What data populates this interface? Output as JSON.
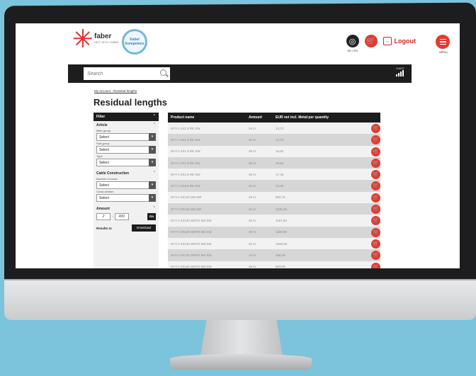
{
  "header": {
    "brand": "faber",
    "brand_sub": "SEIT 1875 • KABEL",
    "seal_text": "Kabel Kompetenz",
    "lang": "DE / EN",
    "logout": "Logout",
    "menu": "MENU"
  },
  "search": {
    "placeholder": "Search",
    "chart_label": "CHART"
  },
  "breadcrumb": "My account › Residual lengths",
  "page_title": "Residual lengths",
  "filter": {
    "title": "Filter",
    "article_title": "Article",
    "main_group_label": "Main group",
    "main_group_value": "Select",
    "sub_group_label": "Sub-group",
    "sub_group_value": "Select",
    "type_label": "Type",
    "type_value": "Select",
    "cable_title": "Cable Construction",
    "cores_label": "Number of cores",
    "cores_value": "Select",
    "cross_label": "Cross-section",
    "cross_value": "Select",
    "amount_title": "Amount",
    "amount_from": "2",
    "amount_sep": "-",
    "amount_to": "499",
    "go": "Go",
    "results_label": "Results to",
    "download": "Download"
  },
  "table": {
    "headers": [
      "Product name",
      "Amount",
      "EUR net incl. Metal per quantity"
    ],
    "rows": [
      [
        "NYY-J 1X1.5 RE SW",
        "25 m",
        "13,73"
      ],
      [
        "NYY-J 3X1.5 RE SW",
        "30 m",
        "13,73"
      ],
      [
        "NYY-J 3X1.5 RE SW",
        "25 m",
        "15,82"
      ],
      [
        "NYY-J 3X1.5 RE SW",
        "36 m",
        "15,84"
      ],
      [
        "NYY-J 3X1.5 RE SW",
        "39 m",
        "17,19"
      ],
      [
        "NYY-J 3X2.5 RE SW",
        "26 m",
        "23,20"
      ],
      [
        "NYY-J 3X120 SM SW",
        "48 m",
        "893,75"
      ],
      [
        "NYY-J 3X120 SM SW",
        "32 m",
        "1135,40"
      ],
      [
        "NYY-J 3X120 SM/70 SM SW",
        "40 m",
        "1157,50"
      ],
      [
        "NYY-J 3X120 SM/70 SM SW",
        "40 m",
        "1159,00"
      ],
      [
        "NYY-J 3X120 SM/70 SM SW",
        "32 m",
        "1028,66"
      ],
      [
        "NYY-J 3X120 SM/70 SM SW",
        "14 m",
        "458,35"
      ],
      [
        "NYY-J 3X120 SM/70 SM SW",
        "28 m",
        "903,09"
      ]
    ]
  },
  "colors": {
    "accent": "#e53a2f",
    "dark": "#1d1d1d",
    "background": "#7cc3dc"
  }
}
